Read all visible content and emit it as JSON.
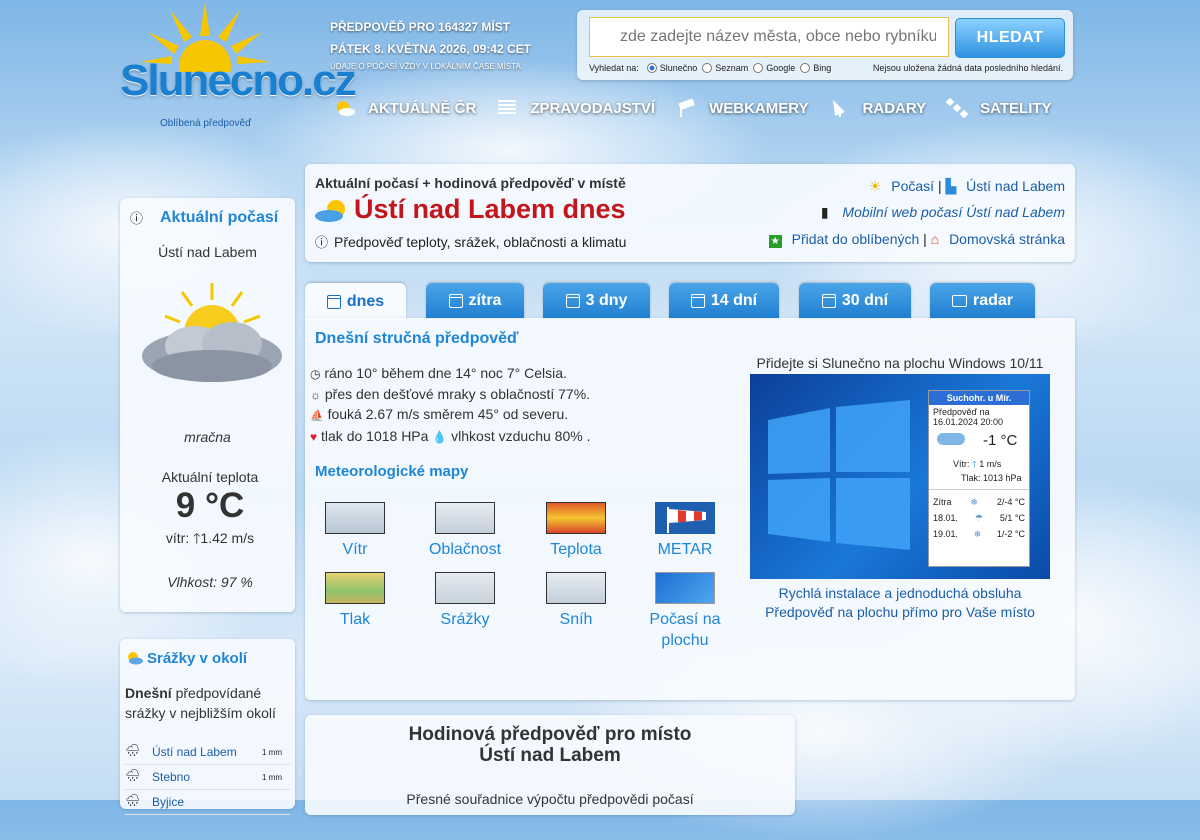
{
  "brand": {
    "logo_text": "Slunecno.cz",
    "favorite": "Oblíbená předpověď"
  },
  "header": {
    "line1": "PŘEDPOVĚĎ PRO 164327 MÍST",
    "line2": "PÁTEK 8. KVĚTNA 2026, 09:42 CET",
    "line3": "ÚDAJE O POČASÍ VŽDY V LOKÁLNÍM ČASE MÍSTA"
  },
  "search": {
    "placeholder": "zde zadejte název města, obce nebo rybníku",
    "button": "HLEDAT",
    "search_on_label": "Vyhledat na:",
    "options": [
      "Slunečno",
      "Seznam",
      "Google",
      "Bing"
    ],
    "selected": "Slunečno",
    "note": "Nejsou uložena žádná data posledního hledání."
  },
  "nav": [
    {
      "label": "AKTUÁLNĚ ČR",
      "icon": "sun-cloud-icon"
    },
    {
      "label": "ZPRAVODAJSTVÍ",
      "icon": "news-icon"
    },
    {
      "label": "WEBKAMERY",
      "icon": "webcam-icon"
    },
    {
      "label": "RADARY",
      "icon": "radar-icon"
    },
    {
      "label": "SATELITY",
      "icon": "satellite-icon"
    }
  ],
  "current": {
    "title": "Aktuální počasí",
    "place": "Ústí nad Labem",
    "condition": "mračna",
    "temp_label": "Aktuální teplota",
    "temp": "9 °C",
    "wind_label": "vítr:",
    "wind": "1.42 m/s",
    "humidity": "Vlhkost: 97 %"
  },
  "rain_nearby": {
    "title": "Srážky v okolí",
    "intro_bold": "Dnešní",
    "intro_rest": "předpovídané srážky v nejbližším okolí",
    "rows": [
      {
        "place": "Ústí nad Labem",
        "amount": "1 mm"
      },
      {
        "place": "Stebno",
        "amount": "1 mm"
      },
      {
        "place": "Byjice",
        "amount": ""
      }
    ]
  },
  "main": {
    "subtitle": "Aktuální počasí + hodinová předpověď v místě",
    "title": "Ústí nad Labem dnes",
    "description": "Předpověď teploty, srážek, oblačnosti a klimatu",
    "link_weather": "Počasí",
    "link_city": "Ústí nad Labem",
    "link_mobile": "Mobilní web počasí Ústí nad Labem",
    "link_add_fav": "Přidat do oblíbených",
    "link_home": "Domovská stránka",
    "sep": "|"
  },
  "tabs": [
    {
      "label": "dnes",
      "active": true
    },
    {
      "label": "zítra"
    },
    {
      "label": "3 dny"
    },
    {
      "label": "14 dní"
    },
    {
      "label": "30 dní"
    },
    {
      "label": "radar"
    }
  ],
  "summary": {
    "title": "Dnešní stručná předpověď",
    "lines": [
      "ráno 10° během dne 14° noc 7° Celsia.",
      "přes den dešťové mraky s oblačností 77%.",
      "fouká 2.67 m/s směrem 45° od severu.",
      "tlak do 1018 HPa",
      "vlhkost vzduchu 80% ."
    ]
  },
  "maps": {
    "title": "Meteorologické mapy",
    "items": [
      "Vítr",
      "Oblačnost",
      "Teplota",
      "METAR",
      "Tlak",
      "Srážky",
      "Sníh",
      "Počasí na plochu"
    ]
  },
  "promo": {
    "title": "Přidejte si Slunečno na plochu Windows 10/11",
    "line1": "Rychlá instalace a jednoduchá obsluha",
    "line2": "Předpověď na plochu přímo pro Vaše místo",
    "widget": {
      "place": "Suchohr. u Mír.",
      "forecast_label": "Předpověď na",
      "forecast_time": "16.01.2024 20:00",
      "temp": "-1 °C",
      "wind_label": "Vítr:",
      "wind": "1 m/s",
      "pressure": "Tlak: 1013 hPa",
      "days": [
        {
          "day": "Zítra",
          "range": "2/-4 °C"
        },
        {
          "day": "18.01.",
          "range": "5/1 °C"
        },
        {
          "day": "19.01.",
          "range": "1/-2 °C"
        }
      ]
    }
  },
  "hourly": {
    "title_line1": "Hodinová předpověď pro místo",
    "title_line2": "Ústí nad Labem",
    "note": "Přesné souřadnice výpočtu předpovědi počasí"
  },
  "colors": {
    "brand_blue": "#1f86d6",
    "title_red": "#c3161c",
    "tab_blue": "#2b8ad9",
    "search_button": "#2f93e0"
  }
}
